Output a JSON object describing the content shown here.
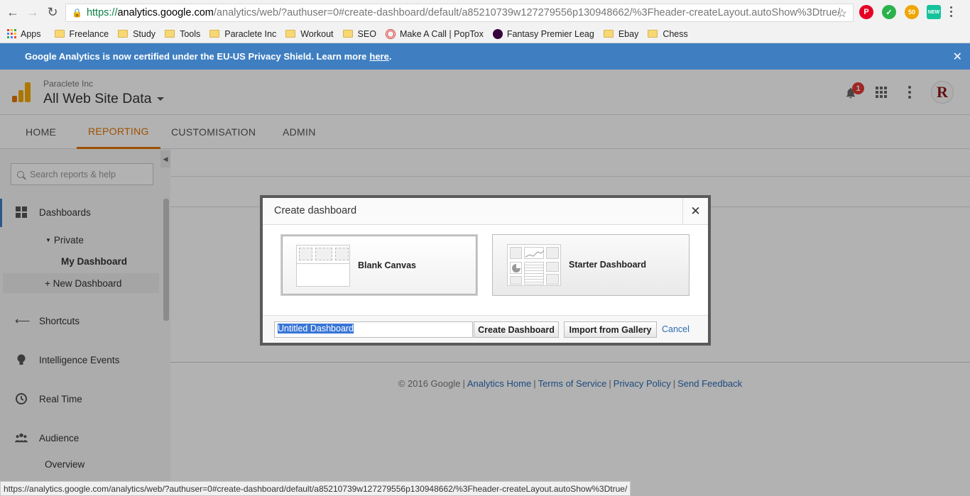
{
  "browser": {
    "url_scheme": "https://",
    "url_host": "analytics.google.com",
    "url_rest": "/analytics/web/?authuser=0#create-dashboard/default/a85210739w127279556p130948662/%3Fheader-createLayout.autoShow%3Dtrue/",
    "bookmarks": [
      {
        "label": "Apps",
        "icon": "apps-grid-icon"
      },
      {
        "label": "Freelance",
        "icon": "folder-icon"
      },
      {
        "label": "Study",
        "icon": "folder-icon"
      },
      {
        "label": "Tools",
        "icon": "folder-icon"
      },
      {
        "label": "Paraclete Inc",
        "icon": "folder-icon"
      },
      {
        "label": "Workout",
        "icon": "folder-icon"
      },
      {
        "label": "SEO",
        "icon": "folder-icon"
      },
      {
        "label": "Make A Call | PopTox",
        "icon": "target-icon"
      },
      {
        "label": "Fantasy Premier Leag",
        "icon": "premier-league-icon"
      },
      {
        "label": "Ebay",
        "icon": "folder-icon"
      },
      {
        "label": "Chess",
        "icon": "folder-icon"
      }
    ],
    "extensions": [
      {
        "name": "pinterest-icon",
        "color": "#e60023",
        "text": "P"
      },
      {
        "name": "check-icon",
        "color": "#2bb24c",
        "text": "✓"
      },
      {
        "name": "so-icon",
        "color": "#f0a500",
        "text": "50"
      },
      {
        "name": "grammarly-new-icon",
        "color": "#15c39a",
        "text": "NEW"
      }
    ],
    "status_url": "https://analytics.google.com/analytics/web/?authuser=0#create-dashboard/default/a85210739w127279556p130948662/%3Fheader-createLayout.autoShow%3Dtrue/"
  },
  "notice": {
    "text": "Google Analytics is now certified under the EU-US Privacy Shield. Learn more",
    "link": "here",
    "suffix": "."
  },
  "header": {
    "account": "Paraclete Inc",
    "property": "All Web Site Data",
    "notification_count": "1",
    "avatar_letter": "R"
  },
  "tabs": [
    "HOME",
    "REPORTING",
    "CUSTOMISATION",
    "ADMIN"
  ],
  "active_tab": "REPORTING",
  "sidebar": {
    "search_placeholder": "Search reports & help",
    "dashboards": "Dashboards",
    "private": "Private",
    "my_dashboard": "My Dashboard",
    "new_dashboard": "+ New Dashboard",
    "shortcuts": "Shortcuts",
    "intelligence": "Intelligence Events",
    "realtime": "Real Time",
    "audience": "Audience",
    "overview": "Overview"
  },
  "footer": {
    "copyright": "© 2016 Google",
    "links": [
      "Analytics Home",
      "Terms of Service",
      "Privacy Policy",
      "Send Feedback"
    ]
  },
  "dialog": {
    "title": "Create dashboard",
    "options": [
      "Blank Canvas",
      "Starter Dashboard"
    ],
    "name_value": "Untitled Dashboard",
    "create_label": "Create Dashboard",
    "import_label": "Import from Gallery",
    "cancel_label": "Cancel"
  },
  "colors": {
    "accent": "#e37400",
    "notice_bg": "#3f7fc1",
    "link": "#2a6bb5"
  }
}
